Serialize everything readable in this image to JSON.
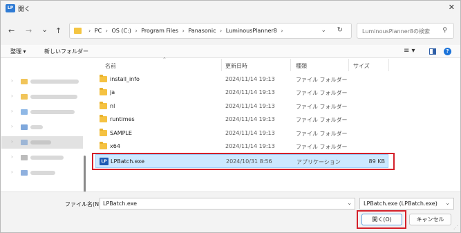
{
  "window": {
    "title": "開く",
    "app_icon_text": "LP"
  },
  "nav": {
    "back": "←",
    "forward": "→",
    "recent": "⌄",
    "up": "↑",
    "breadcrumbs": [
      "PC",
      "OS (C:)",
      "Program Files",
      "Panasonic",
      "LuminousPlanner8"
    ],
    "separator": "›",
    "search_placeholder": "LuminousPlanner8の検索"
  },
  "toolbar": {
    "organize": "整理 ▾",
    "new_folder": "新しいフォルダー",
    "view": "≡ ▾",
    "help": "?"
  },
  "columns": {
    "name": "名前",
    "modified": "更新日時",
    "type": "種類",
    "size": "サイズ"
  },
  "files": [
    {
      "name": "install_info",
      "date": "2024/11/14 19:13",
      "type": "ファイル フォルダー",
      "size": ""
    },
    {
      "name": "ja",
      "date": "2024/11/14 19:13",
      "type": "ファイル フォルダー",
      "size": ""
    },
    {
      "name": "nl",
      "date": "2024/11/14 19:13",
      "type": "ファイル フォルダー",
      "size": ""
    },
    {
      "name": "runtimes",
      "date": "2024/11/14 19:13",
      "type": "ファイル フォルダー",
      "size": ""
    },
    {
      "name": "SAMPLE",
      "date": "2024/11/14 19:13",
      "type": "ファイル フォルダー",
      "size": ""
    },
    {
      "name": "x64",
      "date": "2024/11/14 19:13",
      "type": "ファイル フォルダー",
      "size": ""
    },
    {
      "name": "LPBatch.exe",
      "date": "2024/10/31 8:56",
      "type": "アプリケーション",
      "size": "89 KB"
    }
  ],
  "bottom": {
    "filename_label": "ファイル名(N):",
    "filename_value": "LPBatch.exe",
    "filter_value": "LPBatch.exe (LPBatch.exe)",
    "open_label": "開く(O)",
    "cancel_label": "キャンセル"
  },
  "colors": {
    "accent": "#1b73d9",
    "highlight": "#d4202a",
    "selection": "#cce8ff",
    "folder": "#f5c242"
  }
}
